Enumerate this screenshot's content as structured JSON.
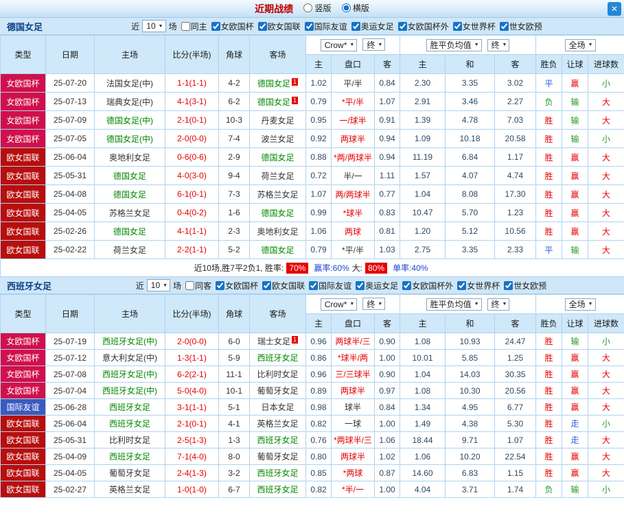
{
  "titlebar": {
    "title": "近期战绩",
    "options": [
      {
        "label": "竖版",
        "checked": false
      },
      {
        "label": "横版",
        "checked": true
      }
    ]
  },
  "icons": {
    "close": "✕",
    "chevron_down": "▼"
  },
  "filters": {
    "near_label": "近",
    "count": "10",
    "games_label": "场",
    "competitions": [
      {
        "label": "女欧国杯",
        "checked": true
      },
      {
        "label": "欧女国联",
        "checked": true
      },
      {
        "label": "国际友谊",
        "checked": true
      },
      {
        "label": "奥运女足",
        "checked": true
      },
      {
        "label": "女欧国杯外",
        "checked": true
      },
      {
        "label": "女世界杯",
        "checked": true
      },
      {
        "label": "世女欧预",
        "checked": true
      }
    ]
  },
  "table_head": {
    "cols": [
      "类型",
      "日期",
      "主场",
      "比分(半场)",
      "角球",
      "客场"
    ],
    "odds_source": "Crow*",
    "final_label": "终",
    "avg_label": "胜平负均值",
    "fulltime_label": "全场",
    "sub_cols": [
      "主",
      "盘口",
      "客",
      "主",
      "和",
      "客",
      "胜负",
      "让球",
      "进球数"
    ]
  },
  "colors": {
    "team_green": "#008800",
    "team_black": "#333333",
    "line_red": "#e60000",
    "type_colors": {
      "女欧国杯": "#d0104c",
      "欧女国联": "#b80e0e",
      "国际友谊": "#3a5bbf"
    },
    "results": {
      "red": "#e60000",
      "green": "#1f9a1f",
      "blue": "#2b5fd9"
    }
  },
  "sections": [
    {
      "team": "德国女足",
      "same_filter": {
        "label": "同主",
        "checked": false
      },
      "rows": [
        {
          "type": "女欧国杯",
          "date": "25-07-20",
          "home": "法国女足(中)",
          "home_green": false,
          "score": "1-1(1-1)",
          "corners": "4-2",
          "away": "德国女足",
          "away_green": true,
          "away_mark": "1",
          "ah": [
            "1.02",
            "平/半",
            "0.84"
          ],
          "ah_red": false,
          "avg": [
            "2.30",
            "3.35",
            "3.02"
          ],
          "res": [
            "平",
            "赢",
            "小"
          ],
          "res_c": [
            "blue",
            "red",
            "green"
          ]
        },
        {
          "type": "女欧国杯",
          "date": "25-07-13",
          "home": "瑞典女足(中)",
          "home_green": false,
          "score": "4-1(3-1)",
          "corners": "6-2",
          "away": "德国女足",
          "away_green": true,
          "away_mark": "1",
          "ah": [
            "0.79",
            "*平/半",
            "1.07"
          ],
          "ah_red": true,
          "avg": [
            "2.91",
            "3.46",
            "2.27"
          ],
          "res": [
            "负",
            "输",
            "大"
          ],
          "res_c": [
            "green",
            "green",
            "red"
          ]
        },
        {
          "type": "女欧国杯",
          "date": "25-07-09",
          "home": "德国女足(中)",
          "home_green": true,
          "score": "2-1(0-1)",
          "corners": "10-3",
          "away": "丹麦女足",
          "away_green": false,
          "away_mark": "",
          "ah": [
            "0.95",
            "一/球半",
            "0.91"
          ],
          "ah_red": true,
          "avg": [
            "1.39",
            "4.78",
            "7.03"
          ],
          "res": [
            "胜",
            "输",
            "大"
          ],
          "res_c": [
            "red",
            "green",
            "red"
          ]
        },
        {
          "type": "女欧国杯",
          "date": "25-07-05",
          "home": "德国女足(中)",
          "home_green": true,
          "score": "2-0(0-0)",
          "corners": "7-4",
          "away": "波兰女足",
          "away_green": false,
          "away_mark": "",
          "ah": [
            "0.92",
            "两球半",
            "0.94"
          ],
          "ah_red": true,
          "avg": [
            "1.09",
            "10.18",
            "20.58"
          ],
          "res": [
            "胜",
            "输",
            "小"
          ],
          "res_c": [
            "red",
            "green",
            "green"
          ]
        },
        {
          "type": "欧女国联",
          "date": "25-06-04",
          "home": "奥地利女足",
          "home_green": false,
          "score": "0-6(0-6)",
          "corners": "2-9",
          "away": "德国女足",
          "away_green": true,
          "away_mark": "",
          "ah": [
            "0.88",
            "*两/两球半",
            "0.94"
          ],
          "ah_red": true,
          "avg": [
            "11.19",
            "6.84",
            "1.17"
          ],
          "res": [
            "胜",
            "赢",
            "大"
          ],
          "res_c": [
            "red",
            "red",
            "red"
          ]
        },
        {
          "type": "欧女国联",
          "date": "25-05-31",
          "home": "德国女足",
          "home_green": true,
          "score": "4-0(3-0)",
          "corners": "9-4",
          "away": "荷兰女足",
          "away_green": false,
          "away_mark": "",
          "ah": [
            "0.72",
            "半/一",
            "1.11"
          ],
          "ah_red": false,
          "avg": [
            "1.57",
            "4.07",
            "4.74"
          ],
          "res": [
            "胜",
            "赢",
            "大"
          ],
          "res_c": [
            "red",
            "red",
            "red"
          ]
        },
        {
          "type": "欧女国联",
          "date": "25-04-08",
          "home": "德国女足",
          "home_green": true,
          "score": "6-1(0-1)",
          "corners": "7-3",
          "away": "苏格兰女足",
          "away_green": false,
          "away_mark": "",
          "ah": [
            "1.07",
            "两/两球半",
            "0.77"
          ],
          "ah_red": true,
          "avg": [
            "1.04",
            "8.08",
            "17.30"
          ],
          "res": [
            "胜",
            "赢",
            "大"
          ],
          "res_c": [
            "red",
            "red",
            "red"
          ]
        },
        {
          "type": "欧女国联",
          "date": "25-04-05",
          "home": "苏格兰女足",
          "home_green": false,
          "score": "0-4(0-2)",
          "corners": "1-6",
          "away": "德国女足",
          "away_green": true,
          "away_mark": "",
          "ah": [
            "0.99",
            "*球半",
            "0.83"
          ],
          "ah_red": true,
          "avg": [
            "10.47",
            "5.70",
            "1.23"
          ],
          "res": [
            "胜",
            "赢",
            "大"
          ],
          "res_c": [
            "red",
            "red",
            "red"
          ]
        },
        {
          "type": "欧女国联",
          "date": "25-02-26",
          "home": "德国女足",
          "home_green": true,
          "score": "4-1(1-1)",
          "corners": "2-3",
          "away": "奥地利女足",
          "away_green": false,
          "away_mark": "",
          "ah": [
            "1.06",
            "两球",
            "0.81"
          ],
          "ah_red": true,
          "avg": [
            "1.20",
            "5.12",
            "10.56"
          ],
          "res": [
            "胜",
            "赢",
            "大"
          ],
          "res_c": [
            "red",
            "red",
            "red"
          ]
        },
        {
          "type": "欧女国联",
          "date": "25-02-22",
          "home": "荷兰女足",
          "home_green": false,
          "score": "2-2(1-1)",
          "corners": "5-2",
          "away": "德国女足",
          "away_green": true,
          "away_mark": "",
          "ah": [
            "0.79",
            "*平/半",
            "1.03"
          ],
          "ah_red": false,
          "avg": [
            "2.75",
            "3.35",
            "2.33"
          ],
          "res": [
            "平",
            "输",
            "大"
          ],
          "res_c": [
            "blue",
            "green",
            "red"
          ]
        }
      ],
      "summary": {
        "prefix": "近10场,胜7平2负1, 胜率:",
        "win_rate": "70%",
        "ah_rate": "赢率:60%",
        "big_label": "大:",
        "big_rate": "80%",
        "single_rate": "单率:40%"
      }
    },
    {
      "team": "西班牙女足",
      "same_filter": {
        "label": "同客",
        "checked": false
      },
      "rows": [
        {
          "type": "女欧国杯",
          "date": "25-07-19",
          "home": "西班牙女足(中)",
          "home_green": true,
          "score": "2-0(0-0)",
          "corners": "6-0",
          "away": "瑞士女足",
          "away_green": false,
          "away_mark": "1",
          "ah": [
            "0.96",
            "两球半/三",
            "0.90"
          ],
          "ah_red": true,
          "avg": [
            "1.08",
            "10.93",
            "24.47"
          ],
          "res": [
            "胜",
            "输",
            "小"
          ],
          "res_c": [
            "red",
            "green",
            "green"
          ]
        },
        {
          "type": "女欧国杯",
          "date": "25-07-12",
          "home": "意大利女足(中)",
          "home_green": false,
          "score": "1-3(1-1)",
          "corners": "5-9",
          "away": "西班牙女足",
          "away_green": true,
          "away_mark": "",
          "ah": [
            "0.86",
            "*球半/两",
            "1.00"
          ],
          "ah_red": true,
          "avg": [
            "10.01",
            "5.85",
            "1.25"
          ],
          "res": [
            "胜",
            "赢",
            "大"
          ],
          "res_c": [
            "red",
            "red",
            "red"
          ]
        },
        {
          "type": "女欧国杯",
          "date": "25-07-08",
          "home": "西班牙女足(中)",
          "home_green": true,
          "score": "6-2(2-1)",
          "corners": "11-1",
          "away": "比利时女足",
          "away_green": false,
          "away_mark": "",
          "ah": [
            "0.96",
            "三/三球半",
            "0.90"
          ],
          "ah_red": true,
          "avg": [
            "1.04",
            "14.03",
            "30.35"
          ],
          "res": [
            "胜",
            "赢",
            "大"
          ],
          "res_c": [
            "red",
            "red",
            "red"
          ]
        },
        {
          "type": "女欧国杯",
          "date": "25-07-04",
          "home": "西班牙女足(中)",
          "home_green": true,
          "score": "5-0(4-0)",
          "corners": "10-1",
          "away": "葡萄牙女足",
          "away_green": false,
          "away_mark": "",
          "ah": [
            "0.89",
            "两球半",
            "0.97"
          ],
          "ah_red": true,
          "avg": [
            "1.08",
            "10.30",
            "20.56"
          ],
          "res": [
            "胜",
            "赢",
            "大"
          ],
          "res_c": [
            "red",
            "red",
            "red"
          ]
        },
        {
          "type": "国际友谊",
          "date": "25-06-28",
          "home": "西班牙女足",
          "home_green": true,
          "score": "3-1(1-1)",
          "corners": "5-1",
          "away": "日本女足",
          "away_green": false,
          "away_mark": "",
          "ah": [
            "0.98",
            "球半",
            "0.84"
          ],
          "ah_red": false,
          "avg": [
            "1.34",
            "4.95",
            "6.77"
          ],
          "res": [
            "胜",
            "赢",
            "大"
          ],
          "res_c": [
            "red",
            "red",
            "red"
          ]
        },
        {
          "type": "欧女国联",
          "date": "25-06-04",
          "home": "西班牙女足",
          "home_green": true,
          "score": "2-1(0-1)",
          "corners": "4-1",
          "away": "英格兰女足",
          "away_green": false,
          "away_mark": "",
          "ah": [
            "0.82",
            "一球",
            "1.00"
          ],
          "ah_red": false,
          "avg": [
            "1.49",
            "4.38",
            "5.30"
          ],
          "res": [
            "胜",
            "走",
            "小"
          ],
          "res_c": [
            "red",
            "blue",
            "green"
          ]
        },
        {
          "type": "欧女国联",
          "date": "25-05-31",
          "home": "比利时女足",
          "home_green": false,
          "score": "2-5(1-3)",
          "corners": "1-3",
          "away": "西班牙女足",
          "away_green": true,
          "away_mark": "",
          "ah": [
            "0.76",
            "*两球半/三",
            "1.06"
          ],
          "ah_red": true,
          "avg": [
            "18.44",
            "9.71",
            "1.07"
          ],
          "res": [
            "胜",
            "走",
            "大"
          ],
          "res_c": [
            "red",
            "blue",
            "red"
          ]
        },
        {
          "type": "欧女国联",
          "date": "25-04-09",
          "home": "西班牙女足",
          "home_green": true,
          "score": "7-1(4-0)",
          "corners": "8-0",
          "away": "葡萄牙女足",
          "away_green": false,
          "away_mark": "",
          "ah": [
            "0.80",
            "两球半",
            "1.02"
          ],
          "ah_red": true,
          "avg": [
            "1.06",
            "10.20",
            "22.54"
          ],
          "res": [
            "胜",
            "赢",
            "大"
          ],
          "res_c": [
            "red",
            "red",
            "red"
          ]
        },
        {
          "type": "欧女国联",
          "date": "25-04-05",
          "home": "葡萄牙女足",
          "home_green": false,
          "score": "2-4(1-3)",
          "corners": "3-2",
          "away": "西班牙女足",
          "away_green": true,
          "away_mark": "",
          "ah": [
            "0.85",
            "*两球",
            "0.87"
          ],
          "ah_red": true,
          "avg": [
            "14.60",
            "6.83",
            "1.15"
          ],
          "res": [
            "胜",
            "赢",
            "大"
          ],
          "res_c": [
            "red",
            "red",
            "red"
          ]
        },
        {
          "type": "欧女国联",
          "date": "25-02-27",
          "home": "英格兰女足",
          "home_green": false,
          "score": "1-0(1-0)",
          "corners": "6-7",
          "away": "西班牙女足",
          "away_green": true,
          "away_mark": "",
          "ah": [
            "0.82",
            "*半/一",
            "1.00"
          ],
          "ah_red": true,
          "avg": [
            "4.04",
            "3.71",
            "1.74"
          ],
          "res": [
            "负",
            "输",
            "小"
          ],
          "res_c": [
            "green",
            "green",
            "green"
          ]
        }
      ],
      "summary": null
    }
  ]
}
